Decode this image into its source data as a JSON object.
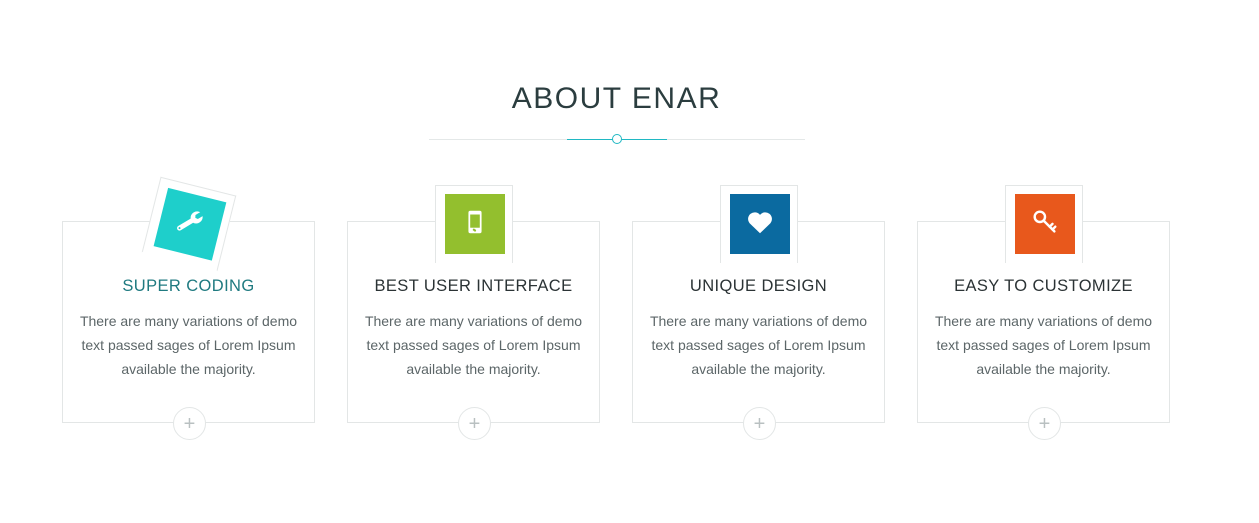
{
  "section": {
    "title": "ABOUT ENAR"
  },
  "colors": {
    "accent": "#20b8c3",
    "teal_icon": "#1ecfcb",
    "green_icon": "#93bf2e",
    "blue_icon": "#0b6aa0",
    "orange_icon": "#e8581c",
    "active_title": "#1f7a80"
  },
  "features": [
    {
      "title": "SUPER CODING",
      "text": "There are many variations of demo text passed sages of Lorem Ipsum available the majority.",
      "icon": "wrench-icon",
      "plus": "+"
    },
    {
      "title": "BEST USER INTERFACE",
      "text": "There are many variations of demo text passed sages of Lorem Ipsum available the majority.",
      "icon": "mobile-icon",
      "plus": "+"
    },
    {
      "title": "UNIQUE DESIGN",
      "text": "There are many variations of demo text passed sages of Lorem Ipsum available the majority.",
      "icon": "heart-icon",
      "plus": "+"
    },
    {
      "title": "EASY TO CUSTOMIZE",
      "text": "There are many variations of demo text passed sages of Lorem Ipsum available the majority.",
      "icon": "key-icon",
      "plus": "+"
    }
  ]
}
